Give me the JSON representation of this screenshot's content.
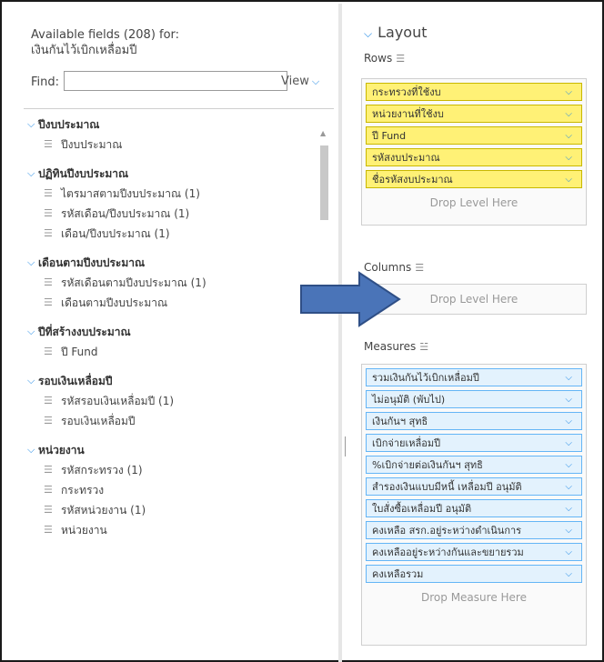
{
  "left": {
    "title_line1": "Available fields (208) for:",
    "title_line2": "เงินกันไว้เบิกเหลื่อมปี",
    "find_label": "Find:",
    "find_value": "",
    "view_label": "View",
    "groups": [
      {
        "label": "ปีงบประมาณ",
        "items": [
          "ปีงบประมาณ"
        ]
      },
      {
        "label": "ปฏิทินปีงบประมาณ",
        "items": [
          "ไตรมาสตามปีงบประมาณ (1)",
          "รหัสเดือน/ปีงบประมาณ (1)",
          "เดือน/ปีงบประมาณ (1)"
        ]
      },
      {
        "label": "เดือนตามปีงบประมาณ",
        "items": [
          "รหัสเดือนตามปีงบประมาณ (1)",
          "เดือนตามปีงบประมาณ"
        ]
      },
      {
        "label": "ปีที่สร้างงบประมาณ",
        "items": [
          "ปี Fund"
        ]
      },
      {
        "label": "รอบเงินเหลื่อมปี",
        "items": [
          "รหัสรอบเงินเหลื่อมปี (1)",
          "รอบเงินเหลื่อมปี"
        ]
      },
      {
        "label": "หน่วยงาน",
        "items": [
          "รหัสกระทรวง (1)",
          "กระทรวง",
          "รหัสหน่วยงาน (1)",
          "หน่วยงาน"
        ]
      }
    ]
  },
  "right": {
    "layout_title": "Layout",
    "rows_label": "Rows",
    "rows": [
      "กระทรวงที่ใช้งบ",
      "หน่วยงานที่ใช้งบ",
      "ปี Fund",
      "รหัสงบประมาณ",
      "ชื่อรหัสงบประมาณ"
    ],
    "rows_drop": "Drop Level Here",
    "columns_label": "Columns",
    "columns_drop": "Drop Level Here",
    "measures_label": "Measures",
    "measures": [
      "รวมเงินกันไว้เบิกเหลื่อมปี",
      "ไม่อนุมัติ (พับไป)",
      "เงินกันฯ สุทธิ",
      "เบิกจ่ายเหลื่อมปี",
      "%เบิกจ่ายต่อเงินกันฯ สุทธิ",
      "สำรองเงินแบบมีหนี้ เหลื่อมปี อนุมัติ",
      "ใบสั่งซื้อเหลื่อมปี อนุมัติ",
      "คงเหลือ สรก.อยู่ระหว่างดำเนินการ",
      "คงเหลืออยู่ระหว่างกันและขยายรวม",
      "คงเหลือรวม"
    ],
    "measures_drop": "Drop Measure Here"
  },
  "colors": {
    "row_pill": "#fff176",
    "measure_pill": "#e3f2fd",
    "accent": "#1e88e5",
    "arrow": "#4a74b8"
  },
  "icons": {
    "field": "layers-icon",
    "expand": "chevron-down-icon",
    "measures": "ruler-icon",
    "arrow": "right-arrow-icon"
  }
}
